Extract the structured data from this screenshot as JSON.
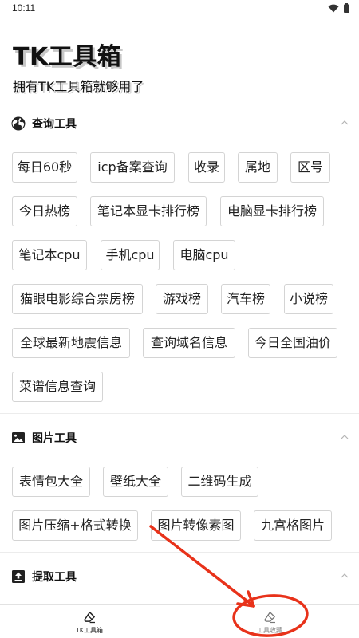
{
  "status": {
    "time": "10:11",
    "wifi_icon": "wifi-icon",
    "battery_icon": "battery-icon"
  },
  "header": {
    "title": "TK工具箱",
    "subtitle": "拥有TK工具箱就够用了"
  },
  "sections": {
    "query": {
      "title": "查询工具",
      "icon": "globe-icon",
      "items": [
        "每日60秒",
        "icp备案查询",
        "收录",
        "属地",
        "区号",
        "今日热榜",
        "笔记本显卡排行榜",
        "电脑显卡排行榜",
        "笔记本cpu",
        "手机cpu",
        "电脑cpu",
        "猫眼电影综合票房榜",
        "游戏榜",
        "汽车榜",
        "小说榜",
        "全球最新地震信息",
        "查询域名信息",
        "今日全国油价",
        "菜谱信息查询"
      ]
    },
    "image": {
      "title": "图片工具",
      "icon": "image-icon",
      "items": [
        "表情包大全",
        "壁纸大全",
        "二维码生成",
        "图片压缩+格式转换",
        "图片转像素图",
        "九宫格图片"
      ]
    },
    "extract": {
      "title": "提取工具",
      "icon": "upload-icon",
      "items": []
    }
  },
  "nav": {
    "items": [
      {
        "label": "TK工具箱",
        "icon": "eraser-icon",
        "active": true
      },
      {
        "label": "工具收藏",
        "icon": "eraser-icon",
        "active": false
      }
    ]
  },
  "colors": {
    "annotation": "#e8321a",
    "chip_border": "#d4d4d4",
    "divider": "#ececec"
  }
}
